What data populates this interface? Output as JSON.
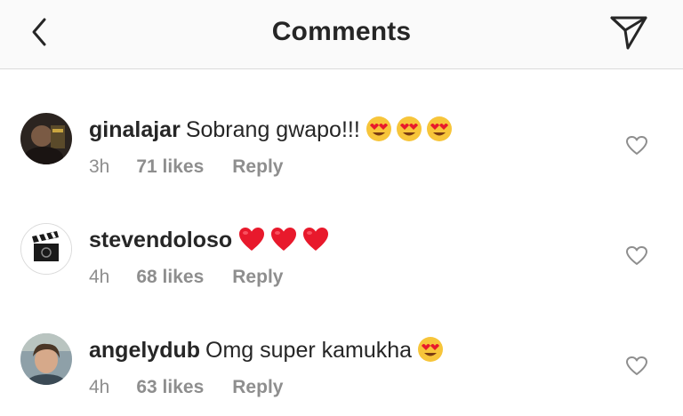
{
  "header": {
    "title": "Comments",
    "back_icon": "chevron-left-icon",
    "share_icon": "paper-plane-icon"
  },
  "comments": [
    {
      "username": "ginalajar",
      "text": "Sobrang gwapo!!!",
      "emojis": [
        "heart-eyes-emoji",
        "heart-eyes-emoji",
        "heart-eyes-emoji"
      ],
      "time": "3h",
      "likes": "71 likes",
      "reply": "Reply"
    },
    {
      "username": "stevendoloso",
      "text": "",
      "emojis": [
        "red-heart-emoji",
        "red-heart-emoji",
        "red-heart-emoji"
      ],
      "time": "4h",
      "likes": "68 likes",
      "reply": "Reply"
    },
    {
      "username": "angelydub",
      "text": "Omg super kamukha",
      "emojis": [
        "heart-eyes-emoji"
      ],
      "time": "4h",
      "likes": "63 likes",
      "reply": "Reply"
    }
  ],
  "colors": {
    "header_bg": "#fafafa",
    "text": "#262626",
    "meta": "#8e8e8e",
    "divider": "#dbdbdb",
    "heart_red": "#e8192c",
    "emoji_yellow": "#f7c53a"
  }
}
